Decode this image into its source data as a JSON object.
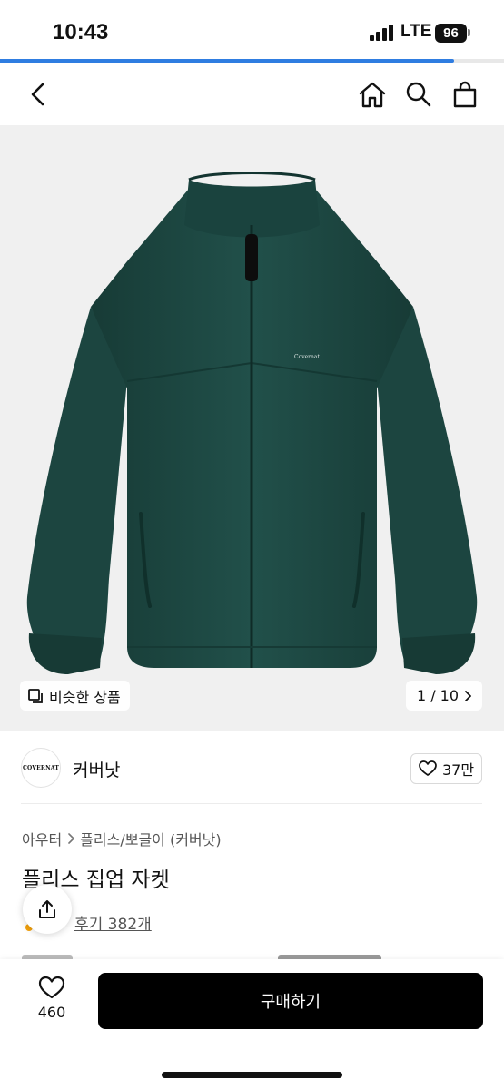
{
  "status_bar": {
    "time": "10:43",
    "network": "LTE",
    "battery": "96"
  },
  "page_progress": 0.9,
  "header": {
    "back_icon": "chevron-left-icon",
    "home_icon": "home-icon",
    "search_icon": "search-icon",
    "cart_icon": "shopping-bag-icon"
  },
  "hero": {
    "brand_print": "Covernat",
    "similar_label": "비슷한 상품",
    "pager": "1 / 10"
  },
  "brand": {
    "logo_text": "COVERNAT",
    "name": "커버낫",
    "likes": "37만"
  },
  "product": {
    "breadcrumb": [
      "아우터",
      "플리스/뽀글이 (커버낫)"
    ],
    "title": "플리스 집업 자켓",
    "reviews": "후기 382개"
  },
  "bottom": {
    "wish_count": "460",
    "buy_label": "구매하기"
  },
  "colors": {
    "jacket": "#1f4a44",
    "buy_button": "#000000",
    "progress": "#2f7de1"
  }
}
